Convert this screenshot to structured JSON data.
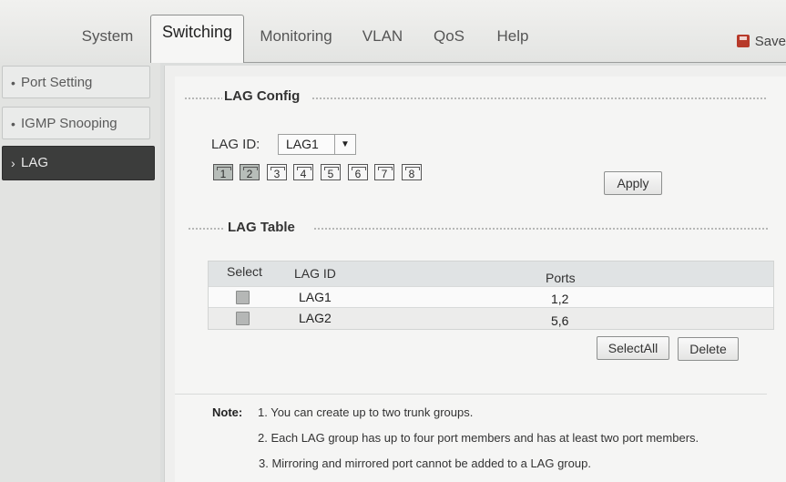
{
  "nav": {
    "tabs": [
      {
        "label": "System"
      },
      {
        "label": "Switching"
      },
      {
        "label": "Monitoring"
      },
      {
        "label": "VLAN"
      },
      {
        "label": "QoS"
      },
      {
        "label": "Help"
      }
    ],
    "active_tab": "Switching",
    "save_label": "Save",
    "save_icon": "save-icon"
  },
  "sidebar": {
    "items": [
      {
        "label": "Port Setting",
        "bullet": "•"
      },
      {
        "label": "IGMP Snooping",
        "bullet": "•"
      },
      {
        "label": "LAG",
        "bullet": "›"
      }
    ],
    "active": "LAG"
  },
  "lag_config": {
    "title": "LAG Config",
    "lag_id_label": "LAG ID:",
    "lag_id_value": "LAG1",
    "ports": [
      {
        "num": "1",
        "selected": true
      },
      {
        "num": "2",
        "selected": true
      },
      {
        "num": "3",
        "selected": false
      },
      {
        "num": "4",
        "selected": false
      },
      {
        "num": "5",
        "selected": false
      },
      {
        "num": "6",
        "selected": false
      },
      {
        "num": "7",
        "selected": false
      },
      {
        "num": "8",
        "selected": false
      }
    ],
    "apply_label": "Apply"
  },
  "lag_table": {
    "title": "LAG Table",
    "columns": [
      "Select",
      "LAG ID",
      "Ports"
    ],
    "rows": [
      {
        "lag_id": "LAG1",
        "ports": "1,2",
        "checked": false
      },
      {
        "lag_id": "LAG2",
        "ports": "5,6",
        "checked": false
      }
    ],
    "select_all_label": "SelectAll",
    "delete_label": "Delete"
  },
  "note": {
    "title": "Note:",
    "lines": [
      "1. You can create up to two trunk groups.",
      "2. Each LAG group has up to four port members and has at least two port members.",
      "3. Mirroring and mirrored port cannot be added to a LAG group."
    ]
  }
}
